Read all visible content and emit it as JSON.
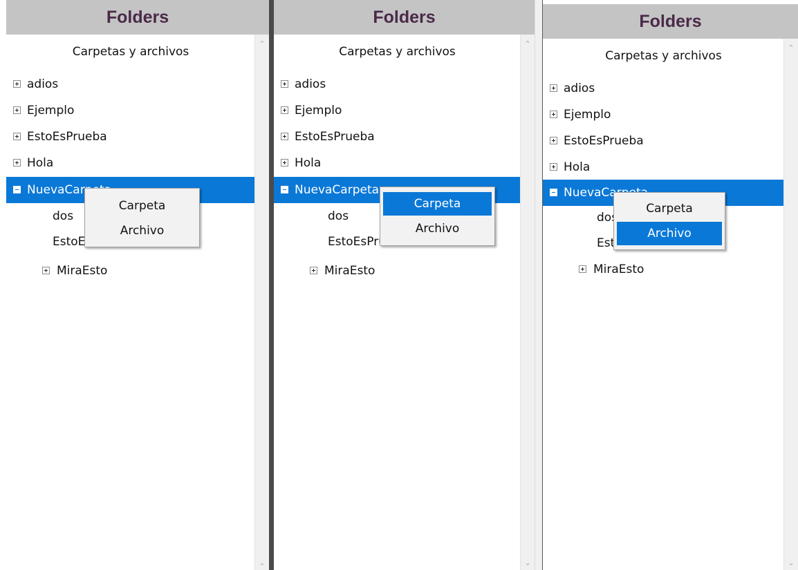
{
  "colors": {
    "header_bg": "#c4c4c4",
    "header_text": "#4a2a48",
    "selection": "#0a78d7",
    "menu_bg": "#f2f2f2"
  },
  "panels": [
    {
      "header": "Folders",
      "tree_title": "Carpetas y archivos",
      "nodes": [
        {
          "label": "adios",
          "expander": "plus-icon"
        },
        {
          "label": "Ejemplo",
          "expander": "plus-icon"
        },
        {
          "label": "EstoEsPrueba",
          "expander": "plus-icon"
        },
        {
          "label": "Hola",
          "expander": "plus-icon"
        },
        {
          "label": "NuevaCarpeta",
          "expander": "minus-icon",
          "selected": true
        },
        {
          "label": "dos"
        },
        {
          "label": "EstoEsPrueba"
        },
        {
          "label": "MiraEsto",
          "expander": "plus-icon"
        }
      ],
      "menu": {
        "items": [
          "Carpeta",
          "Archivo"
        ],
        "highlighted": ""
      },
      "scroll_up_icon": "chevron-up-icon",
      "scroll_down_icon": "chevron-down-icon"
    },
    {
      "header": "Folders",
      "tree_title": "Carpetas y archivos",
      "nodes": [
        {
          "label": "adios",
          "expander": "plus-icon"
        },
        {
          "label": "Ejemplo",
          "expander": "plus-icon"
        },
        {
          "label": "EstoEsPrueba",
          "expander": "plus-icon"
        },
        {
          "label": "Hola",
          "expander": "plus-icon"
        },
        {
          "label": "NuevaCarpeta",
          "expander": "minus-icon",
          "selected": true
        },
        {
          "label": "dos"
        },
        {
          "label": "EstoEsPrueba"
        },
        {
          "label": "MiraEsto",
          "expander": "plus-icon"
        }
      ],
      "menu": {
        "items": [
          "Carpeta",
          "Archivo"
        ],
        "highlighted": "Carpeta"
      },
      "scroll_up_icon": "chevron-up-icon",
      "scroll_down_icon": "chevron-down-icon"
    },
    {
      "header": "Folders",
      "tree_title": "Carpetas y archivos",
      "nodes": [
        {
          "label": "adios",
          "expander": "plus-icon"
        },
        {
          "label": "Ejemplo",
          "expander": "plus-icon"
        },
        {
          "label": "EstoEsPrueba",
          "expander": "plus-icon"
        },
        {
          "label": "Hola",
          "expander": "plus-icon"
        },
        {
          "label": "NuevaCarpeta",
          "expander": "minus-icon",
          "selected": true
        },
        {
          "label": "dos"
        },
        {
          "label": "EstoEsPrueba"
        },
        {
          "label": "MiraEsto",
          "expander": "plus-icon"
        }
      ],
      "menu": {
        "items": [
          "Carpeta",
          "Archivo"
        ],
        "highlighted": "Archivo"
      },
      "scroll_up_icon": "chevron-up-icon",
      "scroll_down_icon": "chevron-down-icon"
    }
  ]
}
